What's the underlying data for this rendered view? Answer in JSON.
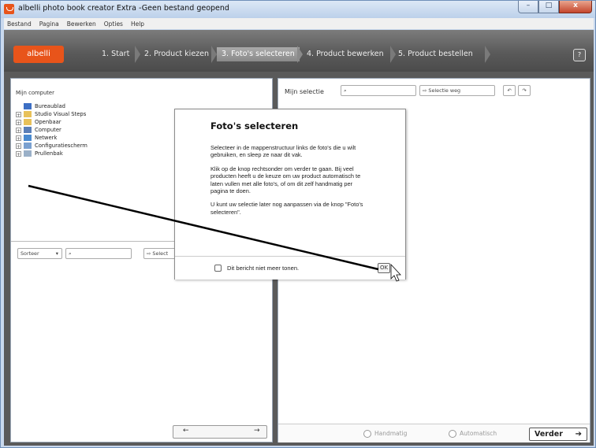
{
  "window": {
    "title": "albelli photo book creator Extra -Geen bestand geopend",
    "controls": {
      "minimize": "–",
      "maximize": "□",
      "close": "x"
    }
  },
  "menu": [
    "Bestand",
    "Pagina",
    "Bewerken",
    "Opties",
    "Help"
  ],
  "wizard": {
    "brand": "albelli",
    "steps": [
      "1. Start",
      "2. Product kiezen",
      "3. Foto's selecteren",
      "4. Product bewerken",
      "5. Product bestellen"
    ],
    "active_step": 2,
    "help": "?"
  },
  "left_panel": {
    "header": "Mijn computer",
    "tree": [
      {
        "label": "Bureaublad",
        "icon": "desktop-icon"
      },
      {
        "label": "Studio Visual Steps",
        "icon": "folder-icon"
      },
      {
        "label": "Openbaar",
        "icon": "folder-icon"
      },
      {
        "label": "Computer",
        "icon": "computer-icon"
      },
      {
        "label": "Netwerk",
        "icon": "network-icon"
      },
      {
        "label": "Configuratiescherm",
        "icon": "control-panel-icon"
      },
      {
        "label": "Prullenbak",
        "icon": "recycle-bin-icon"
      }
    ],
    "sort_label": "Sorteer",
    "select_label": "Select",
    "prev_arrow": "←",
    "next_arrow": "→"
  },
  "right_panel": {
    "header": "Mijn selectie",
    "remove_selection": "Selectie weg",
    "mode_manual": "Handmatig",
    "mode_auto": "Automatisch",
    "next_button": "Verder",
    "next_arrow": "➔"
  },
  "dialog": {
    "title": "Foto's selecteren",
    "paragraphs": [
      "Selecteer in de mappenstructuur links de foto's die u wilt gebruiken, en sleep ze naar dit vak.",
      "Klik op de knop rechtsonder om verder te gaan. Bij veel producten heeft u de keuze om uw product automatisch te laten vullen met alle foto's, of om dit zelf handmatig per pagina te doen.",
      "U kunt uw selectie later nog aanpassen via de knop \"Foto's selecteren\"."
    ],
    "checkbox_label": "Dit bericht niet meer tonen.",
    "ok": "OK"
  },
  "colors": {
    "brand": "#e8541a",
    "wizard_bar": "#5a5a5a",
    "frame": "#c9d9ee"
  }
}
